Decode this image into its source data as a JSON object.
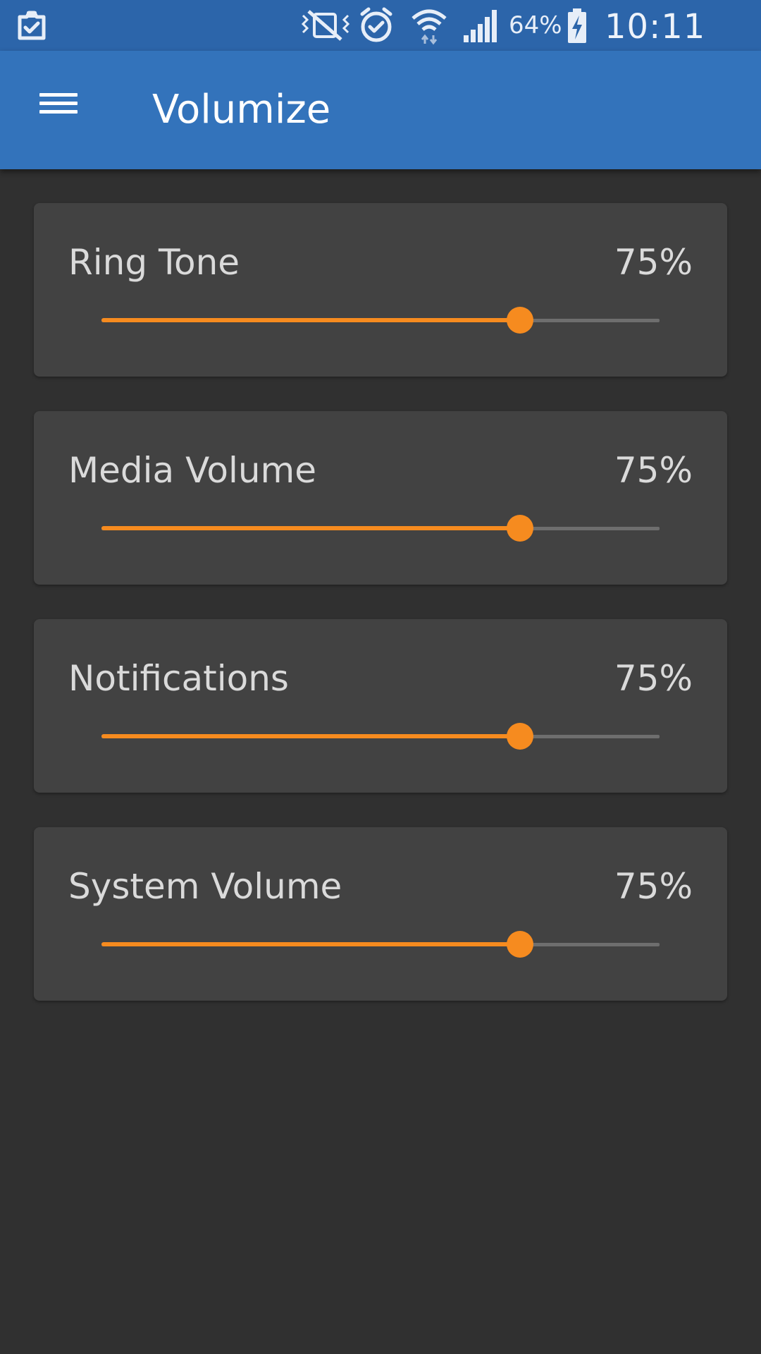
{
  "status_bar": {
    "left_icon": "clipboard-check-icon",
    "icons": [
      "vibrate-mute-icon",
      "alarm-clock-icon",
      "wifi-data-icon",
      "cellular-signal-icon",
      "battery-charging-icon"
    ],
    "battery_percent": "64%",
    "time": "10:11 PM"
  },
  "app_bar": {
    "menu_icon": "hamburger-menu-icon",
    "title": "Volumize",
    "color": "#3373bb"
  },
  "colors": {
    "accent": "#f68b1f",
    "background": "#303030",
    "card": "#424242",
    "status_bar": "#2c65aa"
  },
  "volume_controls": [
    {
      "label": "Ring Tone",
      "value_text": "75%",
      "level": 0.75
    },
    {
      "label": "Media Volume",
      "value_text": "75%",
      "level": 0.75
    },
    {
      "label": "Notifications",
      "value_text": "75%",
      "level": 0.75
    },
    {
      "label": "System Volume",
      "value_text": "75%",
      "level": 0.75
    }
  ]
}
